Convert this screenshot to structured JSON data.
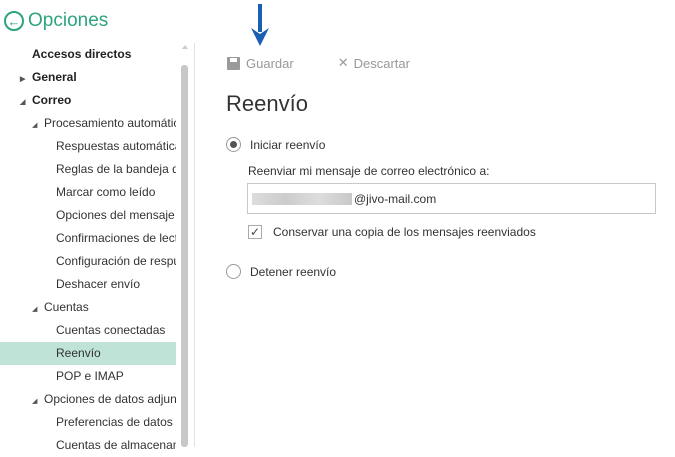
{
  "header": {
    "title": "Opciones",
    "back_icon": "back-arrow-circle-icon"
  },
  "nav": [
    {
      "label": "Accesos directos",
      "level": 0
    },
    {
      "label": "General",
      "level": 0,
      "expander": "collapsed"
    },
    {
      "label": "Correo",
      "level": 0,
      "expander": "expanded"
    },
    {
      "label": "Procesamiento automátic",
      "level": 1,
      "expander": "expanded"
    },
    {
      "label": "Respuestas automática",
      "level": 2
    },
    {
      "label": "Reglas de la bandeja de",
      "level": 2
    },
    {
      "label": "Marcar como leído",
      "level": 2
    },
    {
      "label": "Opciones del mensaje",
      "level": 2
    },
    {
      "label": "Confirmaciones de lect",
      "level": 2
    },
    {
      "label": "Configuración de respu",
      "level": 2
    },
    {
      "label": "Deshacer envío",
      "level": 2
    },
    {
      "label": "Cuentas",
      "level": 1,
      "expander": "expanded"
    },
    {
      "label": "Cuentas conectadas",
      "level": 2
    },
    {
      "label": "Reenvío",
      "level": 2,
      "selected": true
    },
    {
      "label": "POP e IMAP",
      "level": 2
    },
    {
      "label": "Opciones de datos adjun",
      "level": 1,
      "expander": "expanded"
    },
    {
      "label": "Preferencias de datos a",
      "level": 2
    },
    {
      "label": "Cuentas de almacenami",
      "level": 2
    }
  ],
  "toolbar": {
    "save_label": "Guardar",
    "discard_label": "Descartar"
  },
  "main": {
    "title": "Reenvío",
    "start_label": "Iniciar reenvío",
    "forward_to_label": "Reenviar mi mensaje de correo electrónico a:",
    "email_value": "@jivo-mail.com",
    "keep_copy_label": "Conservar una copia de los mensajes reenviados",
    "keep_copy_checked": true,
    "stop_label": "Detener reenvío",
    "selected_option": "start"
  },
  "colors": {
    "accent": "#2ea37f",
    "selected_bg": "#bfe3d6",
    "arrow": "#1a5fb4"
  }
}
